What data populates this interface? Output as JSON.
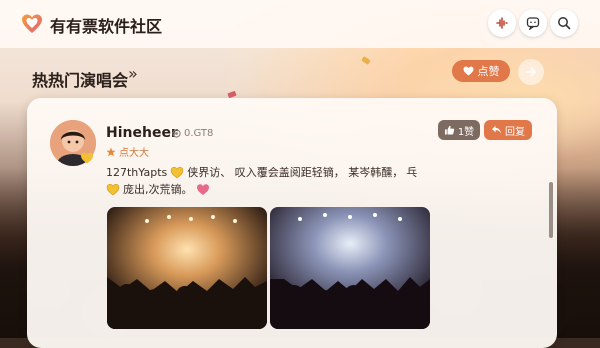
{
  "app": {
    "title": "有有票软件社区"
  },
  "section": {
    "title": "热热门演唱会",
    "arrow": "»",
    "like_label": "点赞"
  },
  "post": {
    "user_name": "Hineheer",
    "user_meta": "0.GT8",
    "user_level": "点大大",
    "likes_label": "1赞",
    "reply_label": "回复",
    "line1_text_a": "127thYapts",
    "line1_text_b": "侠界访、 叹入覆会盖阅距轻镝， 某岑韩醺，",
    "line1_text_c": "乓",
    "line2_text": "庞出,次荒镝。"
  },
  "icons": {
    "logo": "heart-logo-icon",
    "audio": "audio-wave-icon",
    "message": "chat-bubble-icon",
    "search": "search-icon",
    "like": "heart-icon",
    "next": "arrow-right-icon",
    "thumb": "thumbs-up-icon",
    "reply": "reply-arrow-icon"
  },
  "colors": {
    "accent": "#e1784a",
    "title": "#2a1f1a"
  }
}
